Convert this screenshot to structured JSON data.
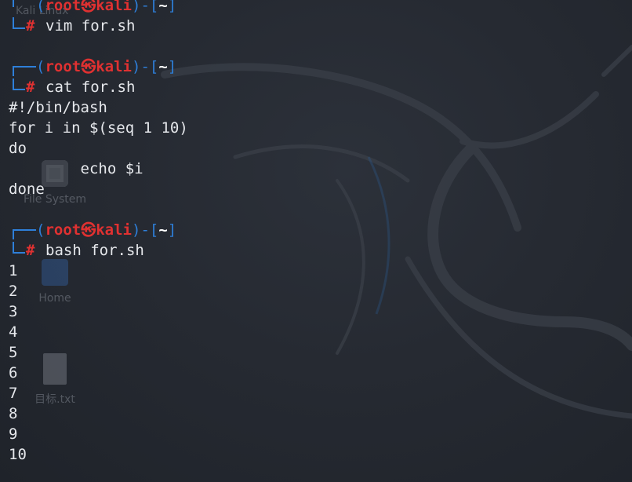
{
  "desktop": {
    "icons": {
      "filesystem_top": "Kali Linux",
      "filesystem": "File System",
      "home": "Home",
      "txt_file": "目标.txt"
    }
  },
  "terminal": {
    "prompt": {
      "open_paren": "┌──(",
      "user": "root",
      "skull": "㉿",
      "host": "kali",
      "sep": ")-[",
      "dir": "~",
      "close": "]",
      "hash": "#"
    },
    "blocks": [
      {
        "command": "vim for.sh",
        "output": []
      },
      {
        "command": "cat for.sh",
        "output": [
          "#!/bin/bash",
          "for i in $(seq 1 10)",
          "do",
          "        echo $i",
          "done"
        ]
      },
      {
        "command": "bash for.sh",
        "output": [
          "1",
          "2",
          "3",
          "4",
          "5",
          "6",
          "7",
          "8",
          "9",
          "10"
        ]
      }
    ]
  },
  "colors": {
    "prompt_blue": "#2e7fd9",
    "prompt_red": "#e03131",
    "text": "#e6e8ec",
    "background": "#23272f"
  }
}
